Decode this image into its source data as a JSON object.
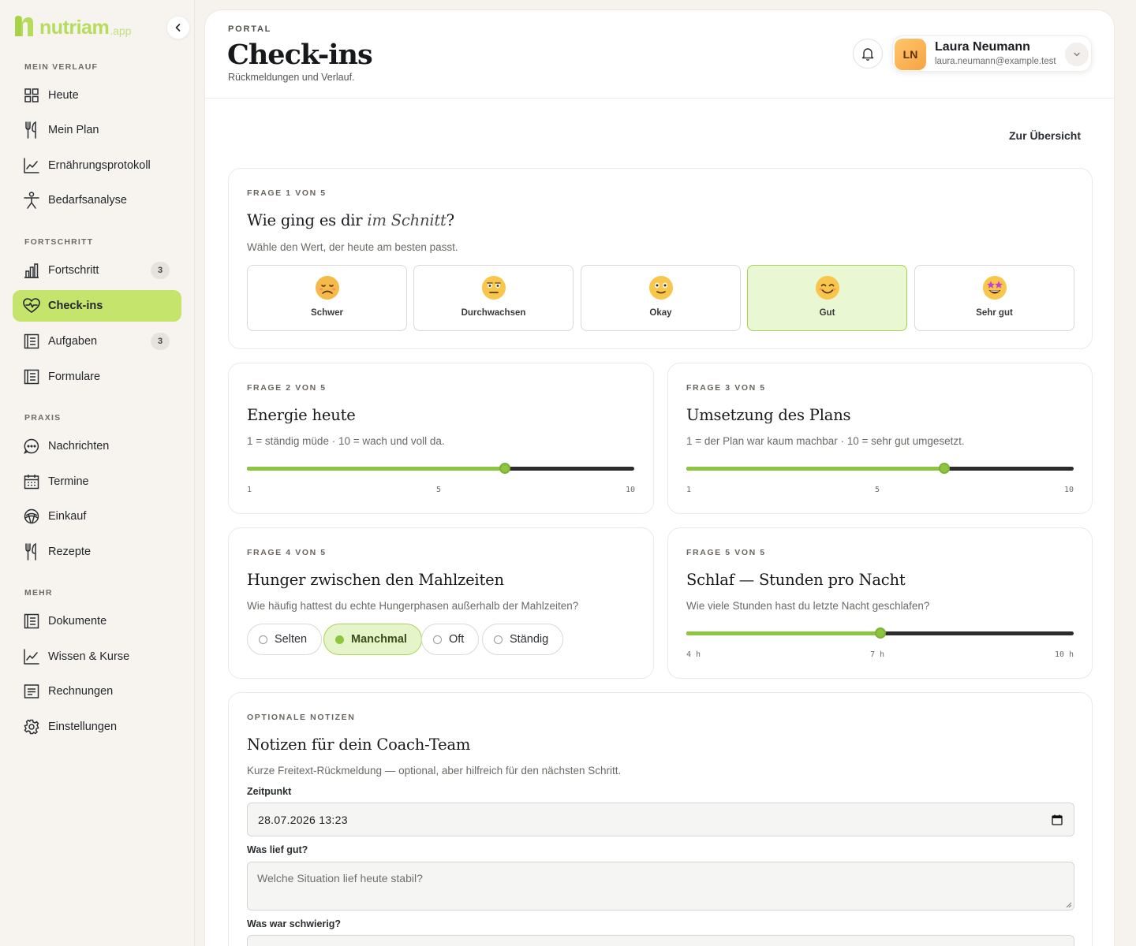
{
  "brand": {
    "name": "nutriam",
    "suffix": ".app",
    "color": "#b5dc5b"
  },
  "sidebar": {
    "sections": {
      "verlauf": "MEIN VERLAUF",
      "fortschritt": "FORTSCHRITT",
      "praxis": "PRAXIS",
      "mehr": "MEHR"
    },
    "items": [
      {
        "label": "Heute",
        "icon": "grid-icon"
      },
      {
        "label": "Mein Plan",
        "icon": "cutlery-icon"
      },
      {
        "label": "Ernährungsprotokoll",
        "icon": "chart-line-icon"
      },
      {
        "label": "Bedarfsanalyse",
        "icon": "person-icon"
      },
      {
        "label": "Fortschritt",
        "icon": "bar-chart-icon",
        "badge": "3"
      },
      {
        "label": "Check-ins",
        "icon": "heart-pulse-icon",
        "active": true
      },
      {
        "label": "Aufgaben",
        "icon": "list-icon",
        "badge": "3"
      },
      {
        "label": "Formulare",
        "icon": "form-icon"
      },
      {
        "label": "Nachrichten",
        "icon": "chat-icon"
      },
      {
        "label": "Termine",
        "icon": "calendar-icon"
      },
      {
        "label": "Einkauf",
        "icon": "basket-icon"
      },
      {
        "label": "Rezepte",
        "icon": "cutlery-icon"
      },
      {
        "label": "Dokumente",
        "icon": "document-icon"
      },
      {
        "label": "Wissen & Kurse",
        "icon": "chart-line-icon"
      },
      {
        "label": "Rechnungen",
        "icon": "invoice-icon"
      },
      {
        "label": "Einstellungen",
        "icon": "gear-icon"
      }
    ]
  },
  "header": {
    "eyebrow": "PORTAL",
    "title": "Check-ins",
    "subtitle": "Rückmeldungen und Verlauf."
  },
  "user": {
    "initials": "LN",
    "name": "Laura Neumann",
    "email": "laura.neumann@example.test"
  },
  "back_link": "Zur Übersicht",
  "q1": {
    "eyebrow": "FRAGE 1 VON 5",
    "title_pre": "Wie ging es dir ",
    "title_em": "im Schnitt",
    "title_post": "?",
    "hint": "Wähle den Wert, der heute am besten passt.",
    "options": [
      "Schwer",
      "Durchwachsen",
      "Okay",
      "Gut",
      "Sehr gut"
    ],
    "selected": "Gut"
  },
  "q2": {
    "eyebrow": "FRAGE 2 VON 5",
    "title": "Energie heute",
    "hint": "1 = ständig müde · 10 = wach und voll da.",
    "ticks": [
      "1",
      "5",
      "10"
    ],
    "value": 7
  },
  "q3": {
    "eyebrow": "FRAGE 3 VON 5",
    "title": "Umsetzung des Plans",
    "hint": "1 = der Plan war kaum machbar · 10 = sehr gut umgesetzt.",
    "ticks": [
      "1",
      "5",
      "10"
    ],
    "value": 7
  },
  "q4": {
    "eyebrow": "FRAGE 4 VON 5",
    "title": "Hunger zwischen den Mahlzeiten",
    "hint": "Wie häufig hattest du echte Hungerphasen außerhalb der Mahlzeiten?",
    "options": [
      "Selten",
      "Manchmal",
      "Oft",
      "Ständig"
    ],
    "selected": "Manchmal"
  },
  "q5": {
    "eyebrow": "FRAGE 5 VON 5",
    "title": "Schlaf — Stunden pro Nacht",
    "hint": "Wie viele Stunden hast du letzte Nacht geschlafen?",
    "ticks": [
      "4 h",
      "7 h",
      "10 h"
    ],
    "value": 7
  },
  "notes": {
    "eyebrow": "OPTIONALE NOTIZEN",
    "title": "Notizen für dein Coach-Team",
    "hint": "Kurze Freitext-Rückmeldung — optional, aber hilfreich für den nächsten Schritt.",
    "time_label": "Zeitpunkt",
    "time_value": "28.07.2026 13:23",
    "good_label": "Was lief gut?",
    "good_placeholder": "Welche Situation lief heute stabil?",
    "hard_label": "Was war schwierig?"
  },
  "colors": {
    "accent": "#c4e46b",
    "slider_fill": "#8cc63f",
    "selected_bg": "#eaf7d3"
  }
}
